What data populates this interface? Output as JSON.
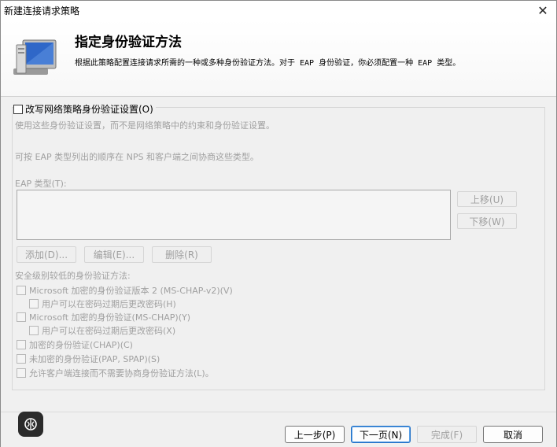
{
  "window": {
    "title": "新建连接请求策略",
    "close_glyph": "✕"
  },
  "header": {
    "heading": "指定身份验证方法",
    "description": "根据此策略配置连接请求所需的一种或多种身份验证方法。对于 EAP 身份验证，你必须配置一种 EAP 类型。"
  },
  "override": {
    "checkbox_label": "改写网络策略身份验证设置(O)",
    "info1": "使用这些身份验证设置，而不是网络策略中的约束和身份验证设置。",
    "info2": "可按 EAP 类型列出的顺序在 NPS 和客户端之间协商这些类型。",
    "eap_label": "EAP 类型(T):",
    "move_up": "上移(U)",
    "move_down": "下移(W)",
    "add": "添加(D)...",
    "edit": "编辑(E)...",
    "remove": "删除(R)",
    "less_secure_label": "安全级别较低的身份验证方法:",
    "options": [
      "Microsoft 加密的身份验证版本 2 (MS-CHAP-v2)(V)",
      "用户可以在密码过期后更改密码(H)",
      "Microsoft 加密的身份验证(MS-CHAP)(Y)",
      "用户可以在密码过期后更改密码(X)",
      "加密的身份验证(CHAP)(C)",
      "未加密的身份验证(PAP, SPAP)(S)",
      "允许客户端连接而不需要协商身份验证方法(L)。"
    ]
  },
  "footer": {
    "back": "上一步(P)",
    "next": "下一页(N)",
    "finish": "完成(F)",
    "cancel": "取消"
  },
  "colors": {
    "disabled_text": "#a0a0a0",
    "accent": "#1f6fc6"
  },
  "icons": [
    "computer-monitor-icon",
    "close-icon",
    "assistant-icon"
  ]
}
